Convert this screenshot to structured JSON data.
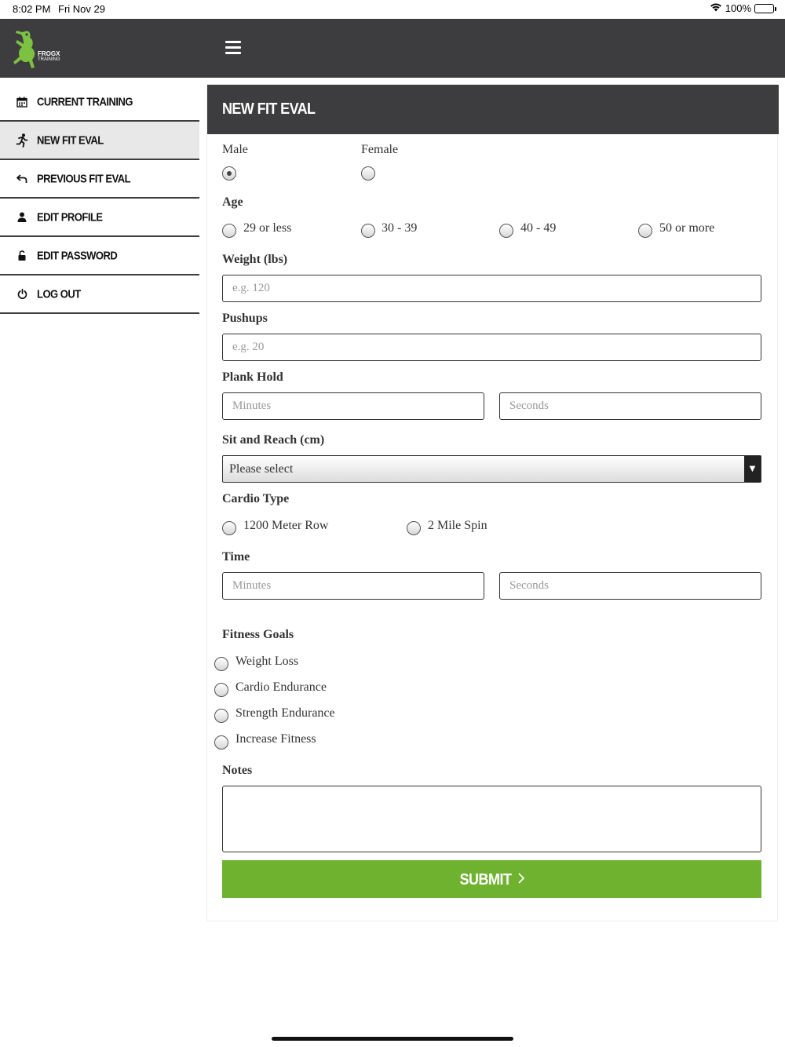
{
  "status_bar": {
    "time": "8:02 PM",
    "date": "Fri Nov 29",
    "battery": "100%",
    "battery_level": 1.0
  },
  "header": {
    "logo_text": "FROGX",
    "logo_subtext": "TRAINING",
    "menu_icon": "hamburger-icon",
    "background": "#3d3d3f"
  },
  "sidebar": {
    "items": [
      {
        "label": "CURRENT TRAINING",
        "icon": "calendar-icon",
        "active": false
      },
      {
        "label": "NEW FIT EVAL",
        "icon": "running-icon",
        "active": true
      },
      {
        "label": "PREVIOUS FIT EVAL",
        "icon": "back-arrow-icon",
        "active": false
      },
      {
        "label": "EDIT PROFILE",
        "icon": "user-icon",
        "active": false
      },
      {
        "label": "EDIT PASSWORD",
        "icon": "lock-icon",
        "active": false
      },
      {
        "label": "LOG OUT",
        "icon": "power-icon",
        "active": false
      }
    ]
  },
  "form": {
    "title": "NEW FIT EVAL",
    "gender": {
      "options": [
        "Male",
        "Female"
      ],
      "selected": "Male"
    },
    "age": {
      "label": "Age",
      "options": [
        "29 or less",
        "30 - 39",
        "40 - 49",
        "50 or more"
      ]
    },
    "weight": {
      "label": "Weight (lbs)",
      "placeholder": "e.g. 120"
    },
    "pushups": {
      "label": "Pushups",
      "placeholder": "e.g. 20"
    },
    "plank": {
      "label": "Plank Hold",
      "minutes_placeholder": "Minutes",
      "seconds_placeholder": "Seconds"
    },
    "sit_reach": {
      "label": "Sit and Reach (cm)",
      "selected": "Please select"
    },
    "cardio": {
      "label": "Cardio Type",
      "options": [
        "1200 Meter Row",
        "2 Mile Spin"
      ]
    },
    "time": {
      "label": "Time",
      "minutes_placeholder": "Minutes",
      "seconds_placeholder": "Seconds"
    },
    "goals": {
      "label": "Fitness Goals",
      "options": [
        "Weight Loss",
        "Cardio Endurance",
        "Strength Endurance",
        "Increase Fitness"
      ]
    },
    "notes": {
      "label": "Notes",
      "value": ""
    },
    "submit_label": "SUBMIT",
    "submit_color": "#6fb230"
  }
}
